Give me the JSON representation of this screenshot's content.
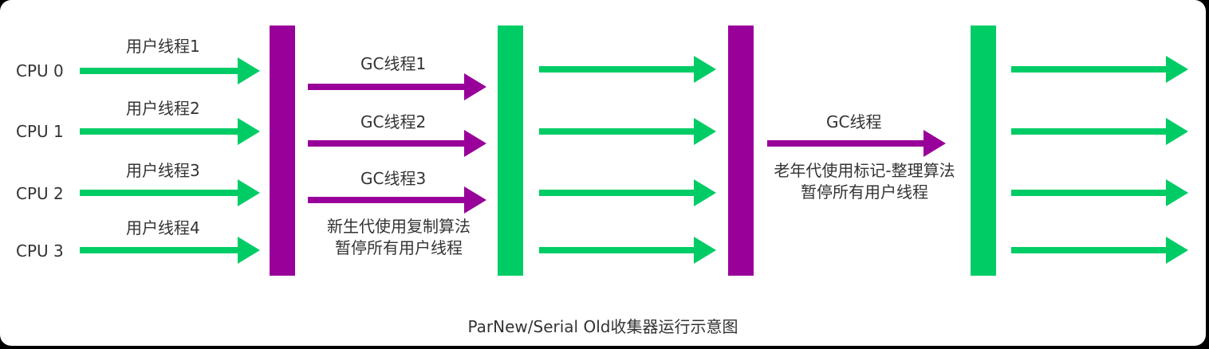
{
  "colors": {
    "user_thread": "#00cc66",
    "gc_thread": "#990099",
    "text": "#333333",
    "background": "#ffffff"
  },
  "cpu_labels": [
    "CPU 0",
    "CPU 1",
    "CPU 2",
    "CPU 3"
  ],
  "user_thread_labels": [
    "用户线程1",
    "用户线程2",
    "用户线程3",
    "用户线程4"
  ],
  "young_gc": {
    "thread_labels": [
      "GC线程1",
      "GC线程2",
      "GC线程3"
    ],
    "caption_line1": "新生代使用复制算法",
    "caption_line2": "暂停所有用户线程"
  },
  "old_gc": {
    "thread_label": "GC线程",
    "caption_line1": "老年代使用标记-整理算法",
    "caption_line2": "暂停所有用户线程"
  },
  "caption": "ParNew/Serial Old收集器运行示意图"
}
